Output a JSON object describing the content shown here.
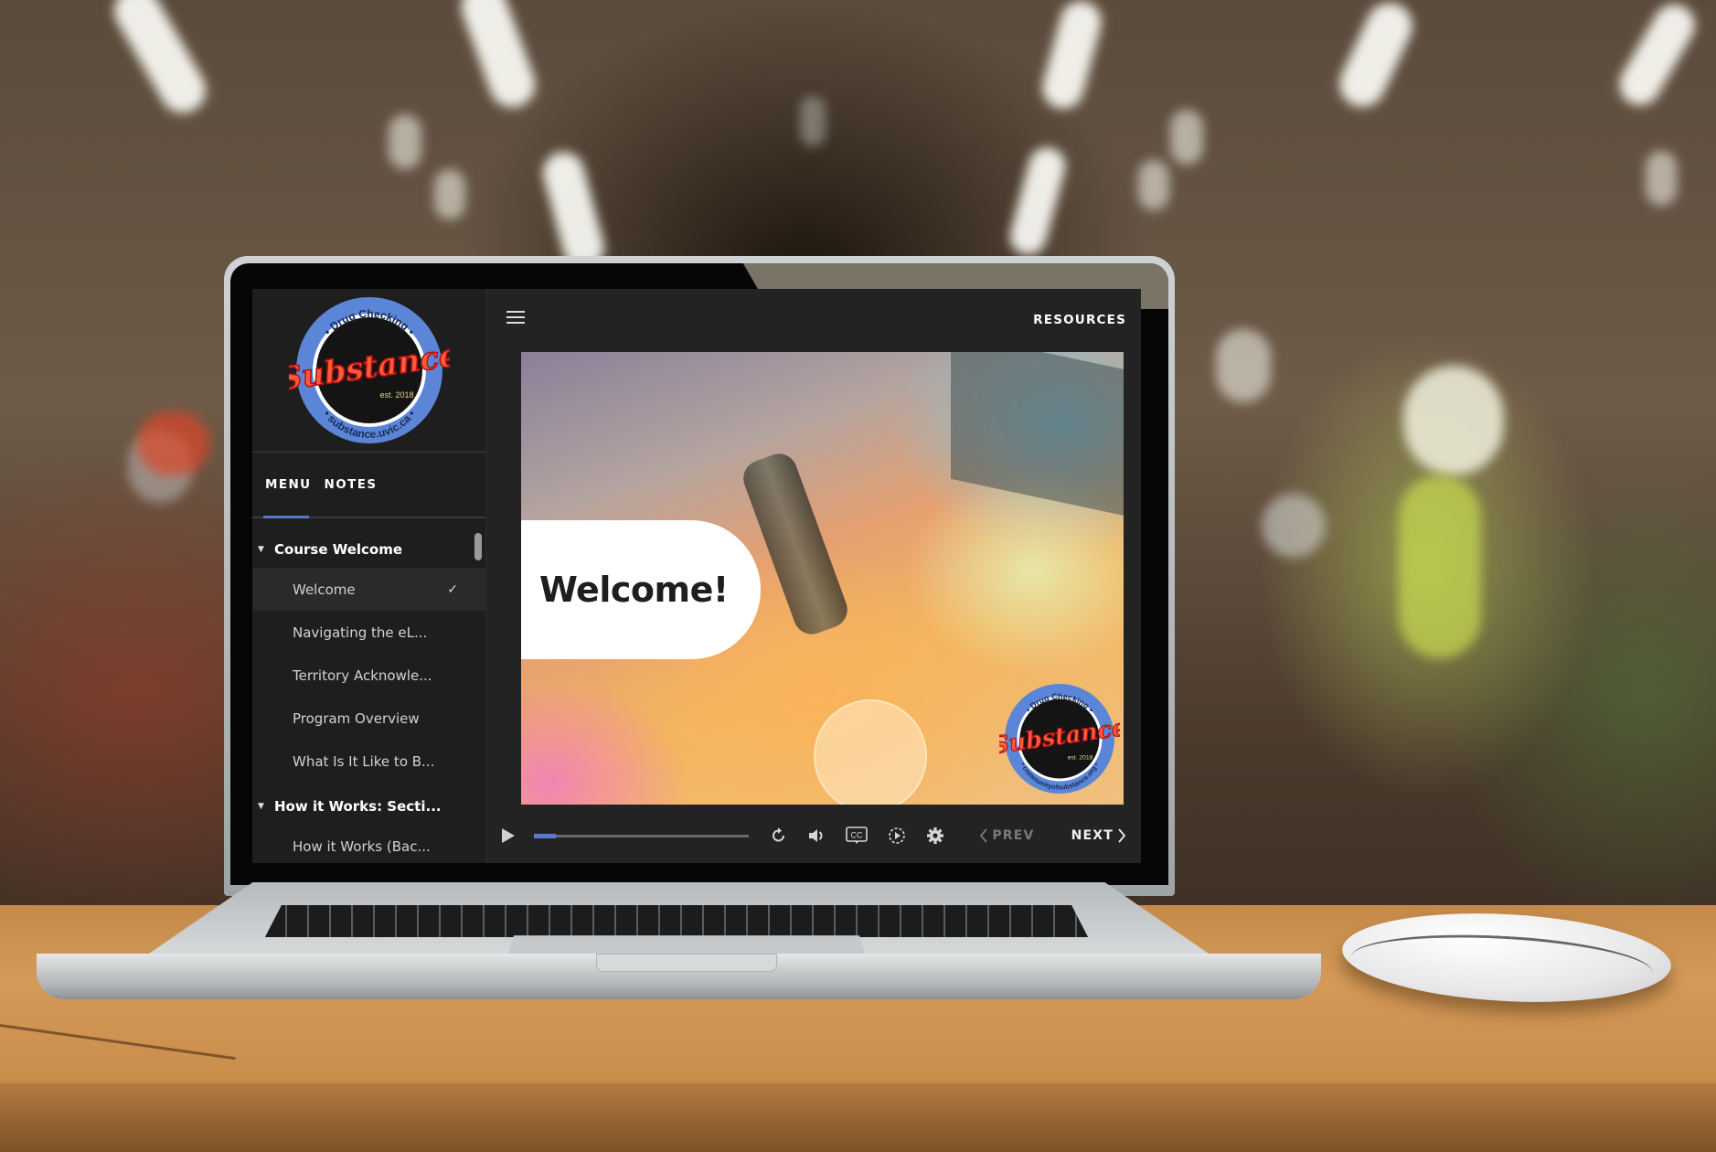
{
  "course_player": {
    "logo": {
      "top_text": "• Drug Checking •",
      "brand": "Substance",
      "est": "est. 2018",
      "bottom_text": "• substance.uvic.ca •"
    },
    "sidebar_tabs": [
      {
        "label": "MENU",
        "active": true
      },
      {
        "label": "NOTES",
        "active": false
      }
    ],
    "menu": {
      "sections": [
        {
          "title": "Course Welcome",
          "expanded": true,
          "lessons": [
            {
              "label": "Welcome",
              "completed": true,
              "active": true
            },
            {
              "label": "Navigating the eL...",
              "completed": false
            },
            {
              "label": "Territory Acknowle...",
              "completed": false
            },
            {
              "label": "Program Overview",
              "completed": false
            },
            {
              "label": "What Is It Like to B...",
              "completed": false
            }
          ]
        },
        {
          "title": "How it Works: Secti...",
          "expanded": true,
          "lessons": [
            {
              "label": "How it Works (Bac...",
              "completed": false
            }
          ]
        }
      ]
    },
    "header": {
      "menu_icon": "hamburger-icon",
      "resources_label": "RESOURCES"
    },
    "slide": {
      "title": "Welcome!",
      "watermark": {
        "top_text": "• Drug Checking •",
        "brand": "Substance",
        "est": "est. 2018",
        "bottom_text": "• communityofsubstance.org •"
      }
    },
    "controls": {
      "play_icon": "play-icon",
      "progress_fraction": 0.1,
      "icons": [
        "replay-icon",
        "volume-icon",
        "closed-captions-icon",
        "playback-speed-icon",
        "settings-gear-icon"
      ],
      "cc_label": "CC",
      "prev_label": "PREV",
      "next_label": "NEXT",
      "accent_color": "#5a7ad0"
    }
  }
}
